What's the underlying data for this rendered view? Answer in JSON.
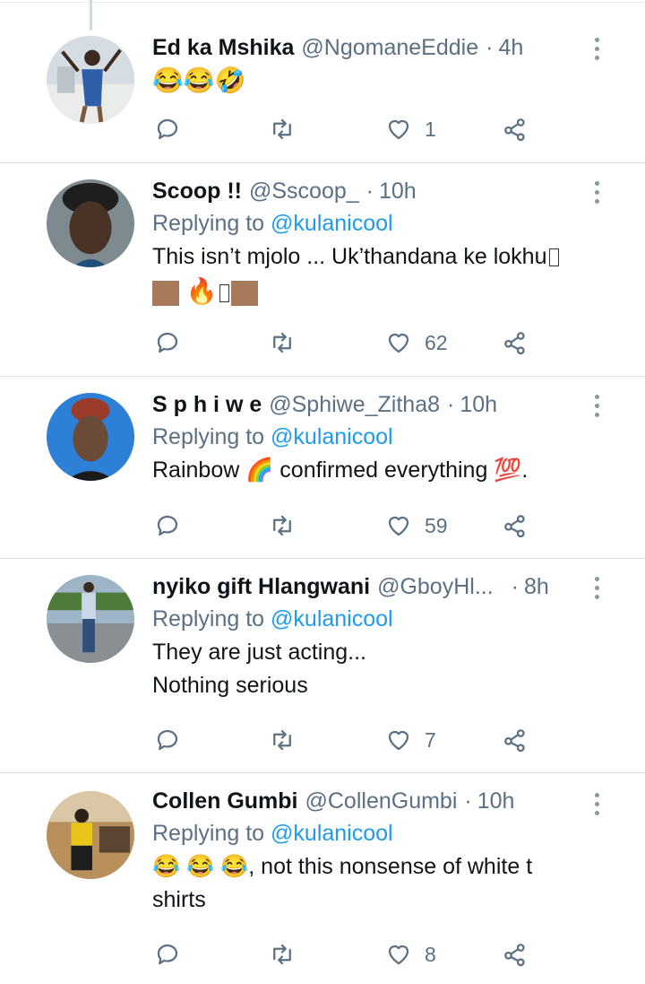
{
  "colors": {
    "link": "#1d9bf0",
    "secondary_text": "#5b7083",
    "primary_text": "#0f1419",
    "divider": "#dfe3e6"
  },
  "icons": {
    "reply": "reply-icon",
    "retweet": "retweet-icon",
    "like": "heart-icon",
    "share": "share-icon",
    "more": "more-options-icon"
  },
  "tweets": [
    {
      "name": "Ed ka Mshika",
      "handle": "@NgomaneEddie",
      "time": "4h",
      "replying_prefix": "",
      "replying_to": "",
      "text_lines": [
        "😂😂🤣"
      ],
      "replies": "",
      "retweets": "",
      "likes": "1"
    },
    {
      "name": "Scoop !!",
      "handle": "@Sscoop_",
      "time": "10h",
      "replying_prefix": "Replying to",
      "replying_to": "@kulanicool",
      "text_lines": [
        "This isn’t mjolo ... Uk’thandana ke lokhu",
        "🔥"
      ],
      "replies": "",
      "retweets": "",
      "likes": "62"
    },
    {
      "name": "S p h i w e",
      "handle": "@Sphiwe_Zitha8",
      "time": "10h",
      "replying_prefix": "Replying to",
      "replying_to": "@kulanicool",
      "text_lines": [
        "Rainbow 🌈 confirmed everything 💯."
      ],
      "replies": "",
      "retweets": "",
      "likes": "59"
    },
    {
      "name": "nyiko gift Hlangwani",
      "handle": "@GboyHl...",
      "time": "8h",
      "replying_prefix": "Replying to",
      "replying_to": "@kulanicool",
      "text_lines": [
        "They are just acting...",
        "Nothing serious"
      ],
      "replies": "",
      "retweets": "",
      "likes": "7"
    },
    {
      "name": "Collen Gumbi",
      "handle": "@CollenGumbi",
      "time": "10h",
      "replying_prefix": "Replying to",
      "replying_to": "@kulanicool",
      "text_lines": [
        "😂 😂 😂, not this nonsense of white t",
        "shirts"
      ],
      "replies": "",
      "retweets": "",
      "likes": "8"
    }
  ]
}
